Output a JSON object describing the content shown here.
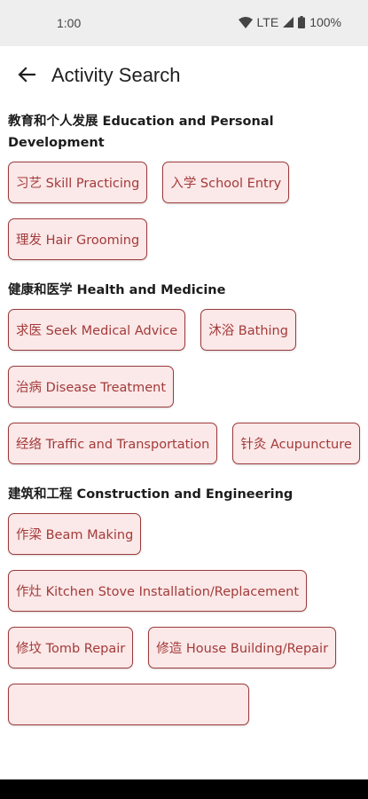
{
  "status": {
    "time": "1:00",
    "network": "LTE",
    "battery": "100%"
  },
  "header": {
    "title": "Activity Search"
  },
  "sections": [
    {
      "title": "教育和个人发展 Education and Personal Development",
      "chips": [
        "习艺 Skill Practicing",
        "入学 School Entry",
        "理发 Hair Grooming"
      ]
    },
    {
      "title": "健康和医学 Health and Medicine",
      "chips": [
        "求医 Seek Medical Advice",
        "沐浴 Bathing",
        "治病 Disease Treatment",
        "经络 Traffic and Transportation",
        "针灸 Acupuncture"
      ]
    },
    {
      "title": "建筑和工程 Construction and Engineering",
      "chips": [
        "作梁 Beam Making",
        "作灶 Kitchen Stove Installation/Replacement",
        "修坟 Tomb Repair",
        "修造 House Building/Repair",
        ""
      ]
    }
  ],
  "colors": {
    "chip_border": "#9c3a3a",
    "chip_bg": "#fbe8e8",
    "chip_text": "#a33a3a"
  }
}
